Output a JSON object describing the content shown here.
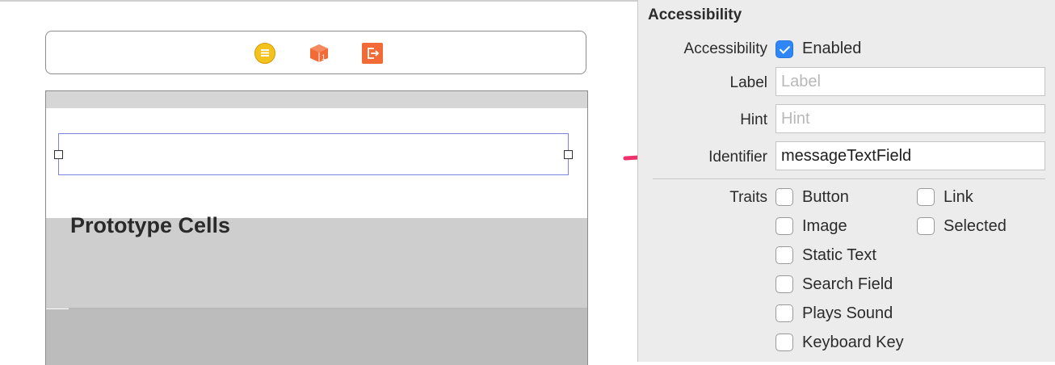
{
  "canvas": {
    "section_title": "Prototype Cells",
    "dock_icons": [
      "view-controller-icon",
      "first-responder-icon",
      "exit-icon"
    ]
  },
  "inspector": {
    "title": "Accessibility",
    "accessibility_label": "Accessibility",
    "enabled_label": "Enabled",
    "enabled_checked": true,
    "label_label": "Label",
    "label_placeholder": "Label",
    "label_value": "",
    "hint_label": "Hint",
    "hint_placeholder": "Hint",
    "hint_value": "",
    "identifier_label": "Identifier",
    "identifier_value": "messageTextField",
    "traits_label": "Traits",
    "traits": [
      {
        "label": "Button",
        "checked": false
      },
      {
        "label": "Link",
        "checked": false
      },
      {
        "label": "Image",
        "checked": false
      },
      {
        "label": "Selected",
        "checked": false
      },
      {
        "label": "Static Text",
        "checked": false
      },
      {
        "label": "Search Field",
        "checked": false
      },
      {
        "label": "Plays Sound",
        "checked": false
      },
      {
        "label": "Keyboard Key",
        "checked": false
      }
    ]
  },
  "colors": {
    "accent": "#2f86f6",
    "arrow": "#f0306a",
    "selection": "#7b84df"
  }
}
